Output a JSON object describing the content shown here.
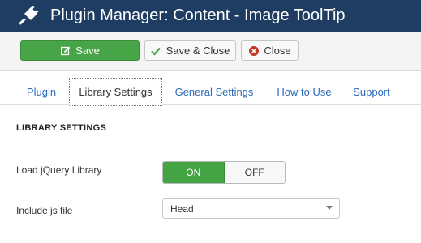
{
  "header": {
    "title": "Plugin Manager: Content - Image ToolTip",
    "icon": "plug-icon",
    "background": "#1f3d62"
  },
  "toolbar": {
    "save_label": "Save",
    "save_close_label": "Save & Close",
    "close_label": "Close",
    "save_color": "#47a447",
    "close_icon_color": "#c0392b"
  },
  "tabs": [
    {
      "label": "Plugin",
      "active": false
    },
    {
      "label": "Library Settings",
      "active": true
    },
    {
      "label": "General Settings",
      "active": false
    },
    {
      "label": "How to Use",
      "active": false
    },
    {
      "label": "Support",
      "active": false
    }
  ],
  "section": {
    "title": "LIBRARY SETTINGS"
  },
  "fields": {
    "load_jquery": {
      "label": "Load jQuery Library",
      "on_label": "ON",
      "off_label": "OFF",
      "value": "ON"
    },
    "include_js": {
      "label": "Include js file",
      "selected": "Head"
    }
  }
}
